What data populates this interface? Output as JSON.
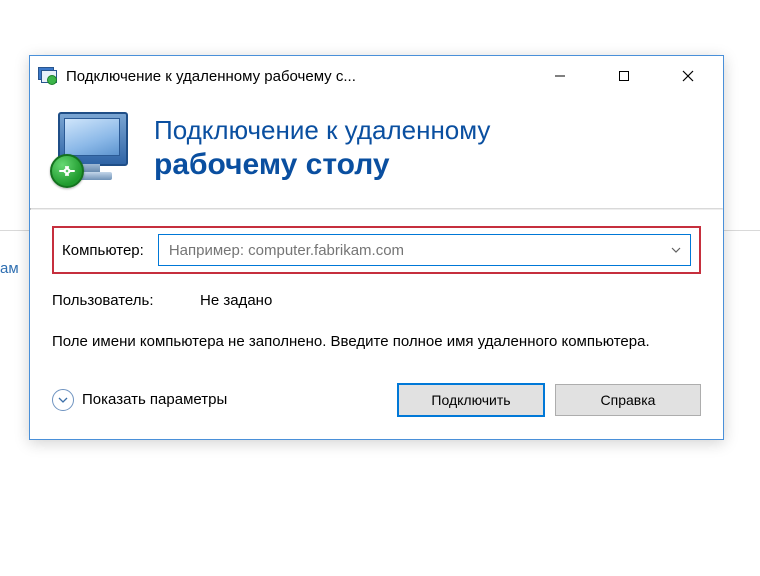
{
  "titlebar": {
    "title": "Подключение к удаленному рабочему с..."
  },
  "banner": {
    "line1": "Подключение к удаленному",
    "line2": "рабочему столу"
  },
  "form": {
    "computer_label": "Компьютер:",
    "computer_placeholder": "Например: computer.fabrikam.com",
    "user_label": "Пользователь:",
    "user_value": "Не задано",
    "hint": "Поле имени компьютера не заполнено. Введите полное имя удаленного компьютера."
  },
  "footer": {
    "options_label": "Показать параметры",
    "connect_label": "Подключить",
    "help_label": "Справка"
  },
  "bg": {
    "stub": "ам"
  }
}
